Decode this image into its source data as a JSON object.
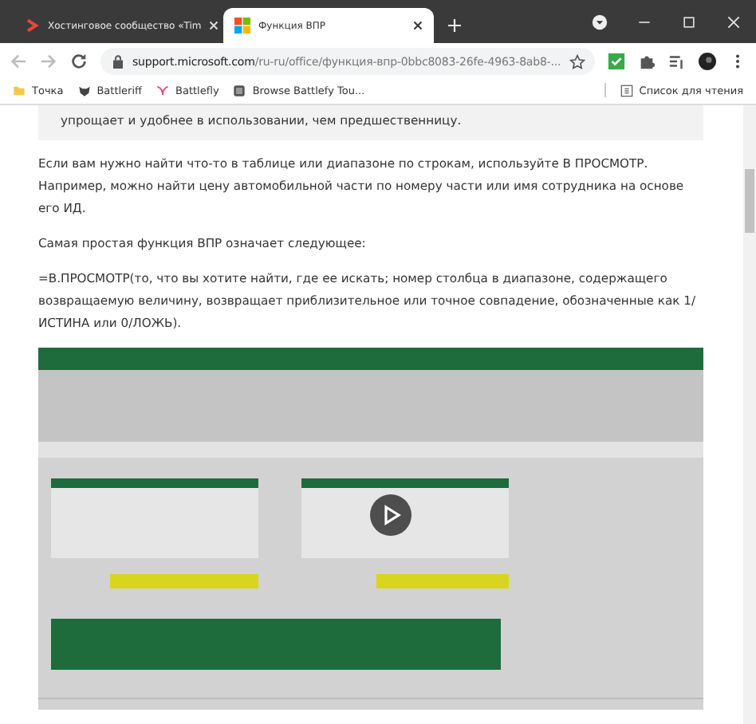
{
  "tabs": [
    {
      "title": "Хостинговое сообщество «Tim",
      "selected": false,
      "kind": "chevron"
    },
    {
      "title": "Функция ВПР",
      "selected": true,
      "kind": "windows"
    }
  ],
  "address": {
    "host": "support.microsoft.com",
    "path": "/ru-ru/office/функция-впр-0bbc8083-26fe-4963-8ab8-..."
  },
  "bookmarks": [
    {
      "label": "Точка",
      "kind": "folder"
    },
    {
      "label": "Battleriff",
      "kind": "mask"
    },
    {
      "label": "Battlefly",
      "kind": "wing"
    },
    {
      "label": "Browse Battlefy Tou...",
      "kind": "page"
    }
  ],
  "reading_list": "Список для чтения",
  "callout": "упрощает и удобнее в использовании, чем предшественницу.",
  "paragraphs": [
    "Если вам нужно найти что-то в таблице или диапазоне по строкам, используйте В ПРОСМОТР. Например, можно найти цену автомобильной части по номеру части или имя сотрудника на основе его ИД.",
    "Самая простая функция ВПР означает следующее:",
    "=В.ПРОСМОТР(то, что вы хотите найти, где ее искать; номер столбца в диапазоне, содержащего возвращаемую величину, возвращает приблизительное или точное совпадение, обозначенные как 1/ИСТИНА или 0/ЛОЖЬ)."
  ],
  "video": {
    "kind": "picture"
  }
}
